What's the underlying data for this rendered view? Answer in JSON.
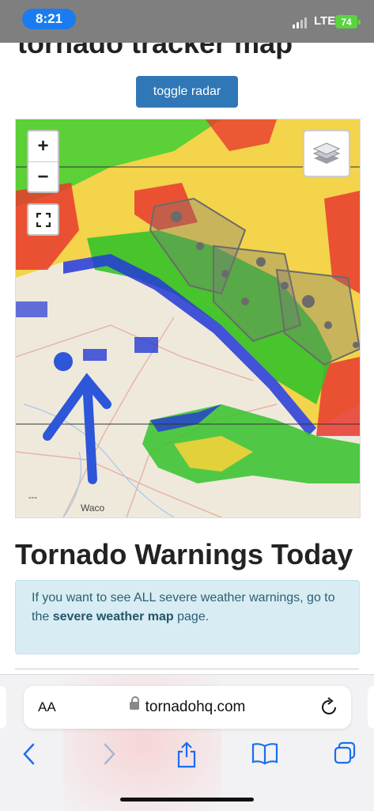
{
  "status_bar": {
    "time": "8:21",
    "network": "LTE",
    "battery": "74"
  },
  "page": {
    "title": "tornado tracker map",
    "toggle_button": "toggle radar",
    "map": {
      "zoom_in": "+",
      "zoom_out": "−",
      "city_labels": [
        "Waco"
      ],
      "scale": "---"
    },
    "warnings_heading": "Tornado Warnings Today",
    "info": {
      "text_before": "If you want to see ALL severe weather warnings, go to the ",
      "link": "severe weather map",
      "text_after": " page."
    }
  },
  "browser": {
    "text_size_button": "AA",
    "url": "tornadohq.com"
  }
}
